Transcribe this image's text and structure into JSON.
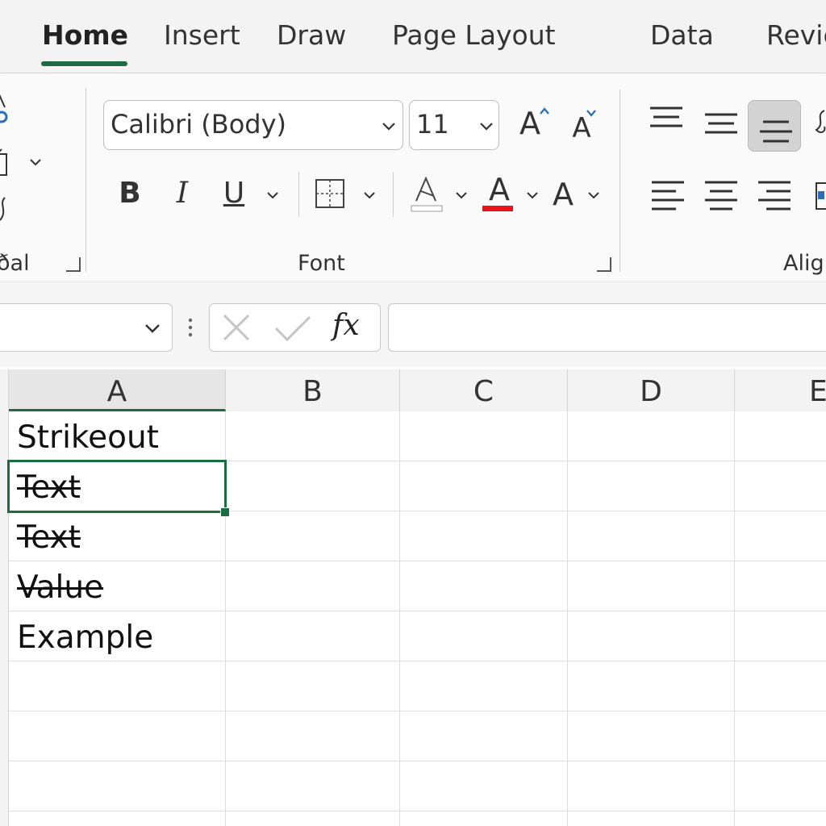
{
  "tabs": {
    "home": "Home",
    "insert": "Insert",
    "draw": "Draw",
    "page_layout": "Page Layout",
    "data": "Data",
    "review": "Revie"
  },
  "ribbon": {
    "clipboard_label": "ðal",
    "font": {
      "family": "Calibri  (Body)",
      "size": "11",
      "group_label": "Font",
      "bold": "B",
      "italic": "I",
      "underline": "U",
      "grow_font": "A",
      "shrink_font": "A",
      "font_color": "A",
      "text_effects": "A",
      "font_color_hex": "#e8141a"
    },
    "alignment": {
      "group_label": "Alig"
    }
  },
  "formula_bar": {
    "fx_label": "fx",
    "name_box_value": "",
    "formula_value": ""
  },
  "grid": {
    "columns": [
      "A",
      "B",
      "C",
      "D",
      "E"
    ],
    "cells_A": [
      {
        "text": "Strikeout",
        "strike": false
      },
      {
        "text": "Text",
        "strike": true
      },
      {
        "text": "Text",
        "strike": true
      },
      {
        "text": "Value",
        "strike": true
      },
      {
        "text": "Example",
        "strike": false
      }
    ],
    "active_cell": "A2"
  },
  "colors": {
    "accent": "#1e6b42",
    "font_color_bar": "#e8141a"
  }
}
